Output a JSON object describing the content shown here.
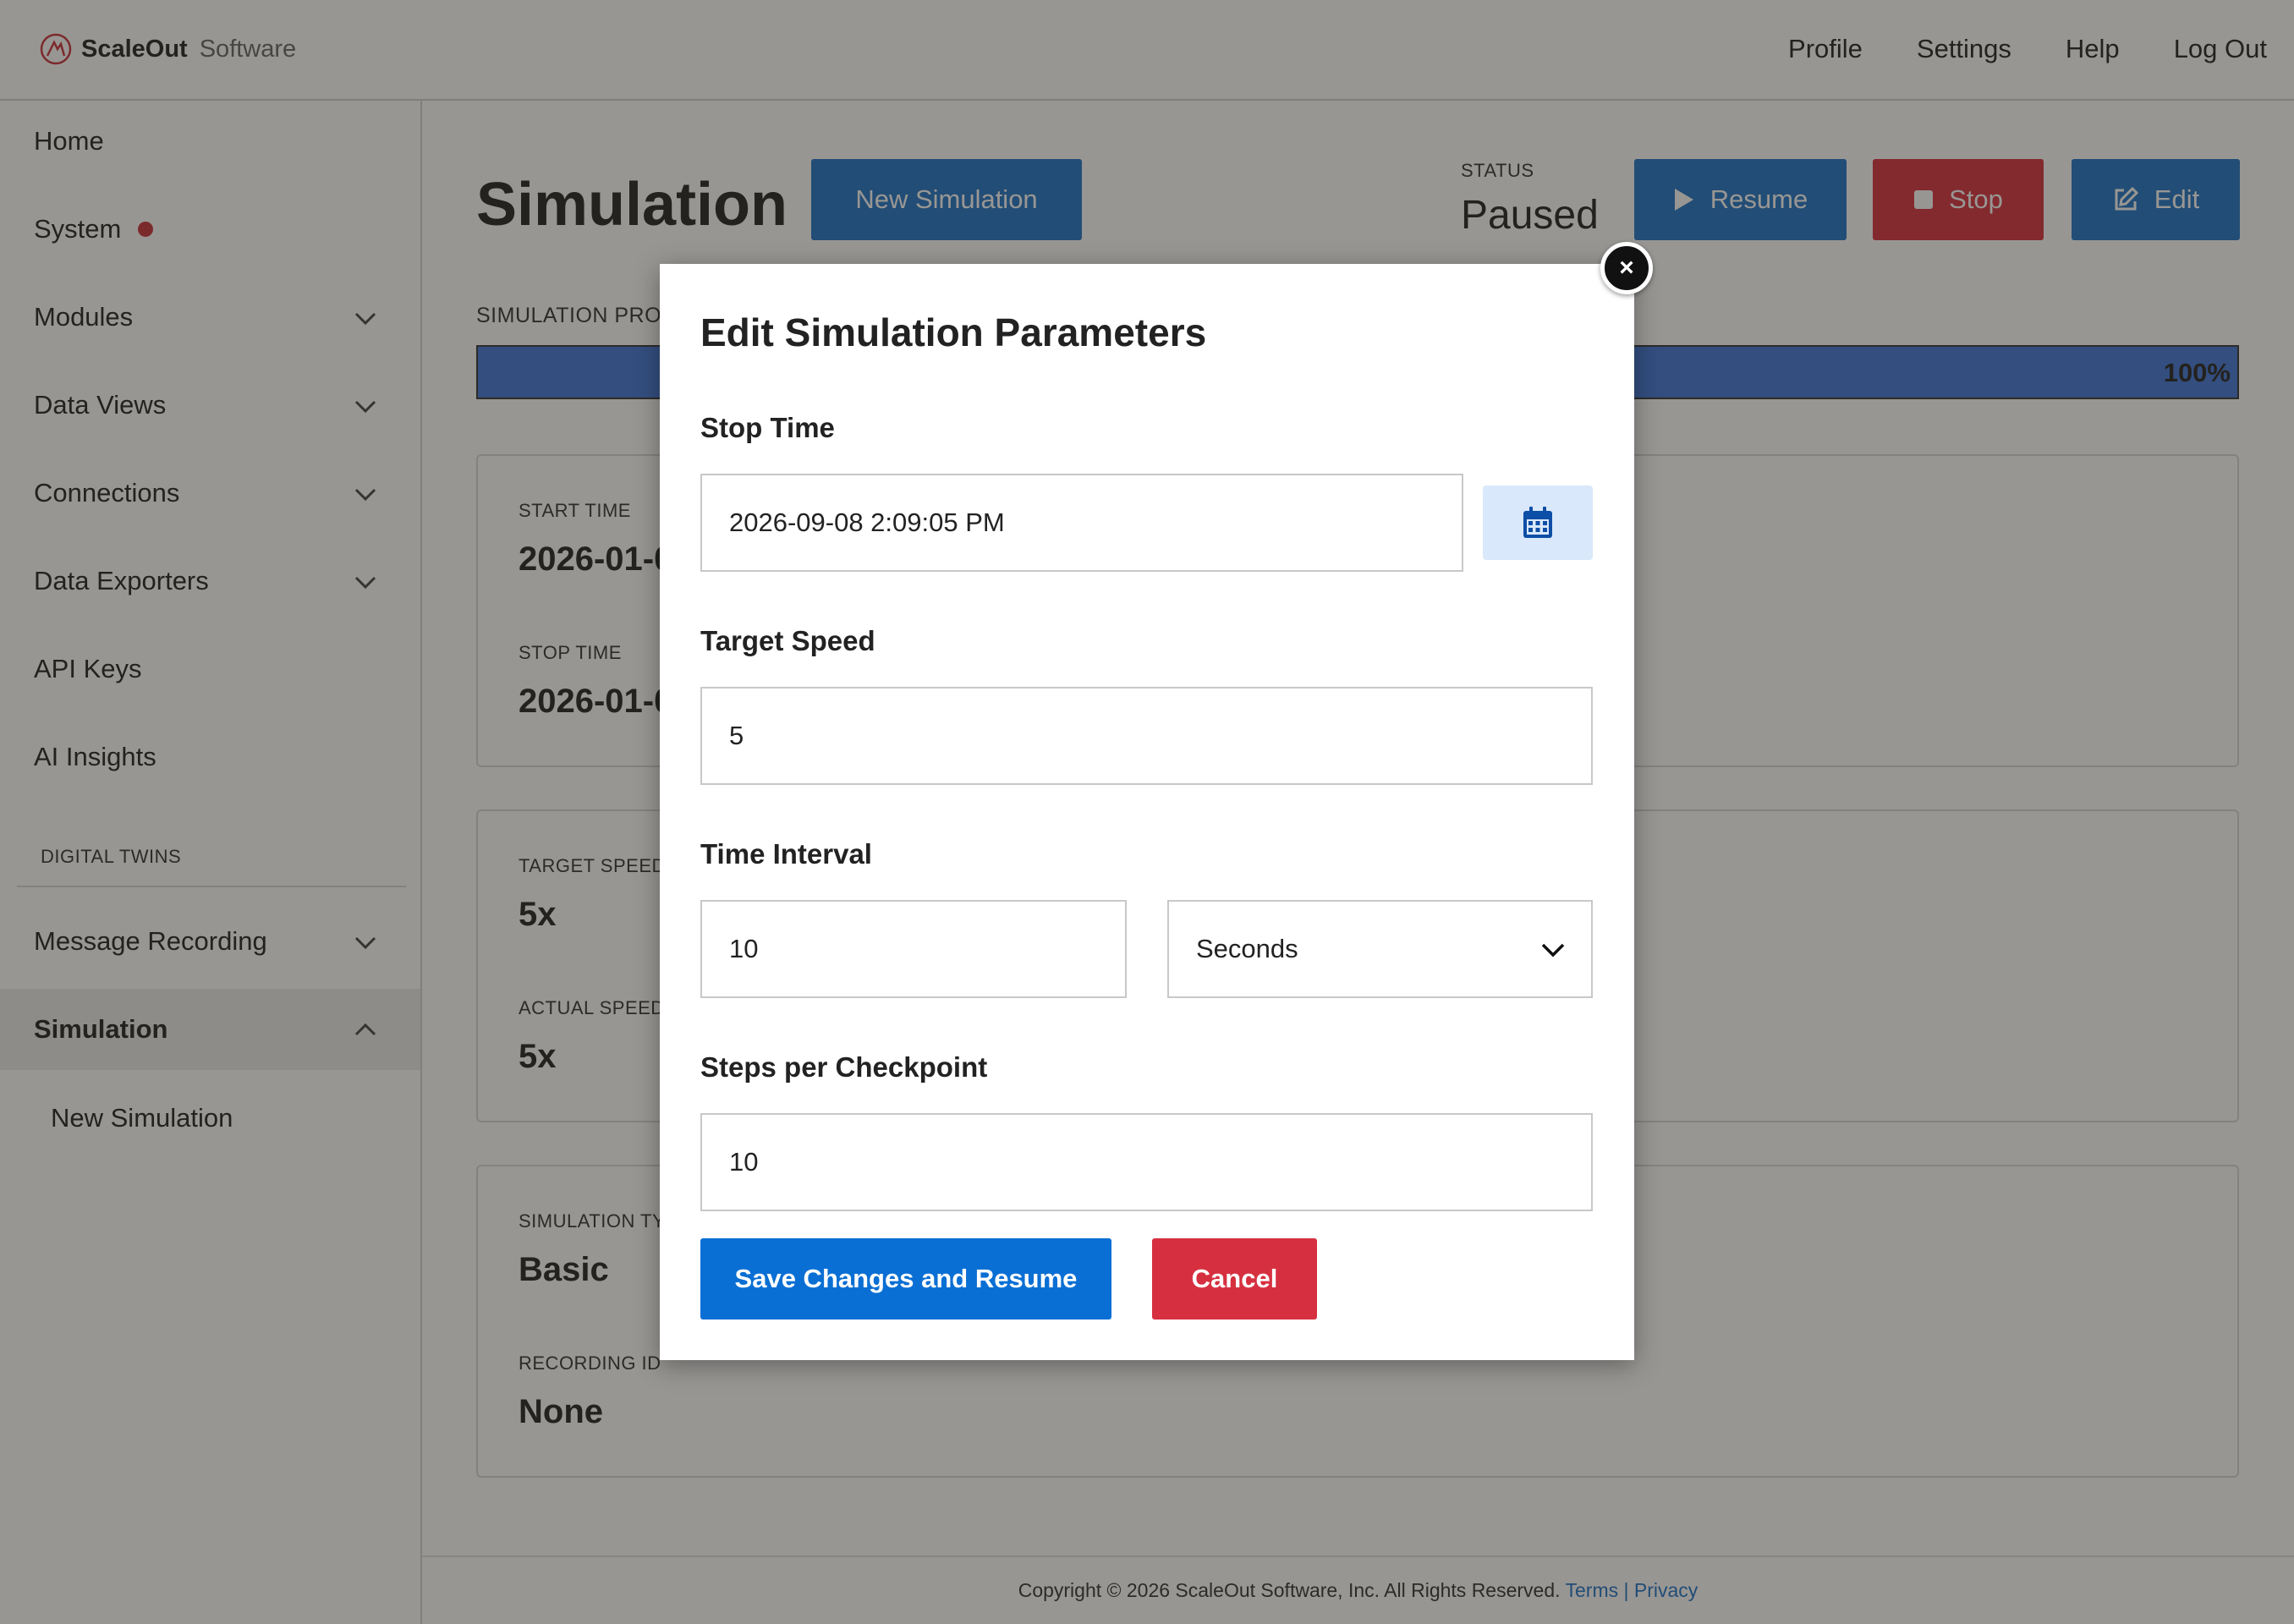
{
  "brand": {
    "name": "ScaleOut",
    "suffix": "Software"
  },
  "topnav": [
    "Profile",
    "Settings",
    "Help",
    "Log Out"
  ],
  "sidebar": {
    "items": [
      {
        "label": "Home"
      },
      {
        "label": "System"
      },
      {
        "label": "Modules"
      },
      {
        "label": "Data Views"
      },
      {
        "label": "Connections"
      },
      {
        "label": "Data Exporters"
      },
      {
        "label": "API Keys"
      },
      {
        "label": "AI Insights"
      }
    ],
    "section_title": "DIGITAL TWINS",
    "twin_items": [
      {
        "label": "Message Recording"
      },
      {
        "label": "Simulation"
      }
    ],
    "sub_items": [
      {
        "label": "New Simulation"
      }
    ]
  },
  "main": {
    "title": "Simulation",
    "new_button": "New Simulation",
    "status_label": "STATUS",
    "status_value": "Paused",
    "resume_button": "Resume",
    "stop_button": "Stop",
    "edit_button": "Edit",
    "progress_label": "SIMULATION PRO",
    "progress_percent_text": "100%",
    "progress_value": 1.0,
    "cards": {
      "time": {
        "start_label": "START TIME",
        "start_value": "2026-01-0",
        "stop_label": "STOP TIME",
        "stop_value": "2026-01-0"
      },
      "speed": {
        "target_label": "TARGET SPEED",
        "target_value": "5x",
        "actual_label": "ACTUAL SPEED",
        "actual_value": "5x"
      },
      "type": {
        "type_label": "SIMULATION TY",
        "type_value": "Basic",
        "recording_label": "RECORDING ID",
        "recording_value": "None"
      }
    }
  },
  "footer": {
    "text": "Copyright © 2026 ScaleOut Software, Inc. All Rights Reserved.",
    "terms": "Terms",
    "separator": "|",
    "privacy": "Privacy"
  },
  "modal": {
    "title": "Edit Simulation Parameters",
    "stop_time_label": "Stop Time",
    "stop_time_value": "2026-09-08 2:09:05 PM",
    "target_speed_label": "Target Speed",
    "target_speed_value": "5",
    "time_interval_label": "Time Interval",
    "time_interval_value": "10",
    "time_interval_unit": "Seconds",
    "steps_label": "Steps per Checkpoint",
    "steps_value": "10",
    "save_button": "Save Changes and Resume",
    "cancel_button": "Cancel",
    "close_symbol": "×"
  },
  "colors": {
    "primary": "#1e73c8",
    "danger": "#d63040",
    "progress": "#3f76d8",
    "calendar_bg": "#d9e8fb"
  }
}
